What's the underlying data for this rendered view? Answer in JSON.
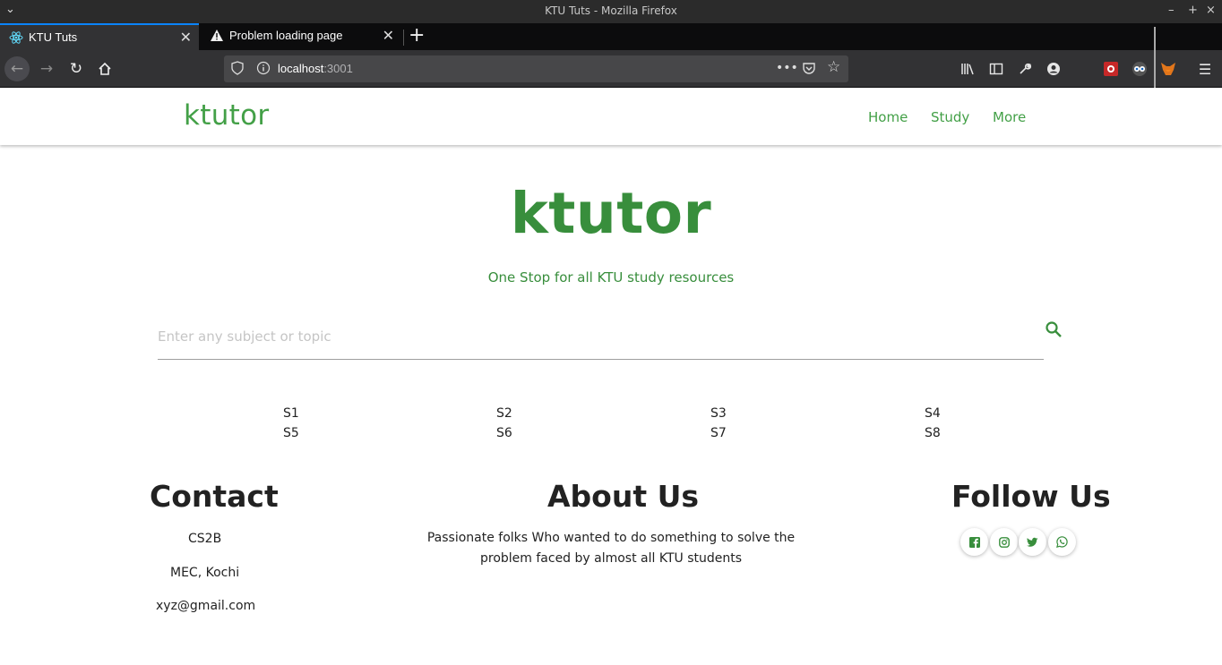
{
  "window": {
    "title": "KTU Tuts - Mozilla Firefox"
  },
  "tabs": [
    {
      "label": "KTU Tuts",
      "active": true,
      "icon": "react-icon"
    },
    {
      "label": "Problem loading page",
      "active": false,
      "icon": "warning-icon"
    }
  ],
  "urlbar": {
    "host": "localhost",
    "port": ":3001"
  },
  "colors": {
    "brand_green": "#43a047",
    "hero_green": "#388e3c",
    "tab_accent": "#0a84ff"
  },
  "site": {
    "brand": "ktutor",
    "nav": [
      "Home",
      "Study",
      "More"
    ],
    "hero_title": "ktutor",
    "hero_subtitle": "One Stop for all KTU study resources",
    "search_placeholder": "Enter any subject or topic",
    "semesters": [
      "S1",
      "S2",
      "S3",
      "S4",
      "S5",
      "S6",
      "S7",
      "S8"
    ]
  },
  "footer": {
    "contact": {
      "heading": "Contact",
      "lines": [
        "CS2B",
        "MEC, Kochi",
        "xyz@gmail.com"
      ]
    },
    "about": {
      "heading": "About Us",
      "text": "Passionate folks Who wanted to do something to solve the problem faced by almost all KTU students"
    },
    "follow": {
      "heading": "Follow Us",
      "icons": [
        "facebook-icon",
        "instagram-icon",
        "twitter-icon",
        "whatsapp-icon"
      ]
    }
  }
}
